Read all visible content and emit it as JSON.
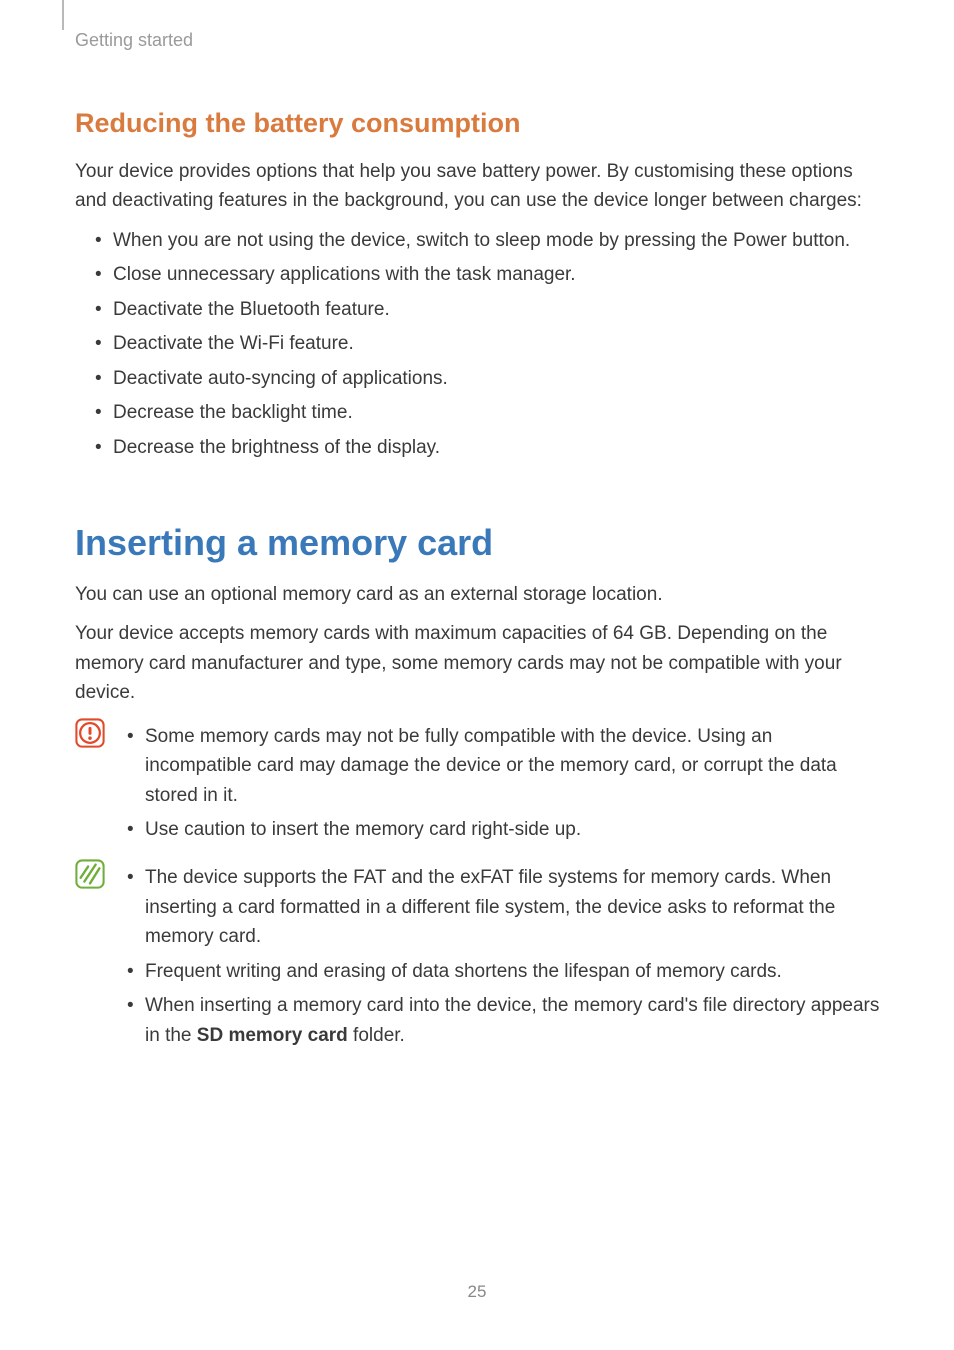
{
  "breadcrumb": "Getting started",
  "sub1": {
    "title": "Reducing the battery consumption",
    "intro": "Your device provides options that help you save battery power. By customising these options and deactivating features in the background, you can use the device longer between charges:",
    "items": [
      "When you are not using the device, switch to sleep mode by pressing the Power button.",
      "Close unnecessary applications with the task manager.",
      "Deactivate the Bluetooth feature.",
      "Deactivate the Wi-Fi feature.",
      "Deactivate auto-syncing of applications.",
      "Decrease the backlight time.",
      "Decrease the brightness of the display."
    ]
  },
  "main": {
    "title": "Inserting a memory card",
    "p1": "You can use an optional memory card as an external storage location.",
    "p2": "Your device accepts memory cards with maximum capacities of 64 GB. Depending on the memory card manufacturer and type, some memory cards may not be compatible with your device."
  },
  "caution": {
    "items": [
      "Some memory cards may not be fully compatible with the device. Using an incompatible card may damage the device or the memory card, or corrupt the data stored in it.",
      "Use caution to insert the memory card right-side up."
    ]
  },
  "note": {
    "items_pre": [
      "The device supports the FAT and the exFAT file systems for memory cards. When inserting a card formatted in a different file system, the device asks to reformat the memory card.",
      "Frequent writing and erasing of data shortens the lifespan of memory cards."
    ],
    "last_pre": "When inserting a memory card into the device, the memory card's file directory appears in the ",
    "last_bold": "SD memory card",
    "last_post": " folder."
  },
  "page_number": "25",
  "icons": {
    "caution": "caution-icon",
    "note": "note-icon"
  }
}
